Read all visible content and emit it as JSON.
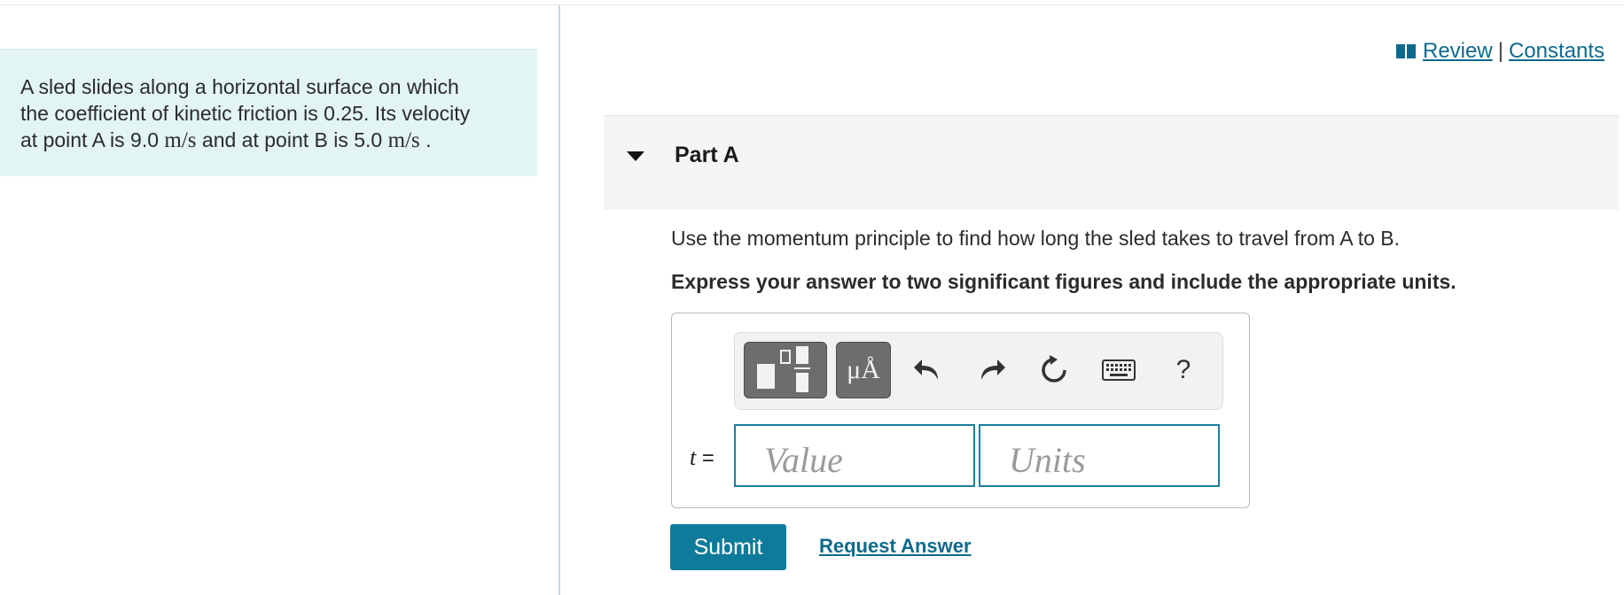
{
  "problem": {
    "line1": "A sled slides along a horizontal surface on which",
    "line2": "the coefficient of kinetic friction is 0.25. Its velocity",
    "line3_start": "at point A is 9.0 ",
    "unit_a": "m/s",
    "line3_mid": " and at point B is 5.0 ",
    "unit_b": "m/s",
    "line3_end": " ."
  },
  "links": {
    "review": " Review",
    "separator": "|",
    "constants": "Constants"
  },
  "part": {
    "title": "Part A"
  },
  "question": "Use the momentum principle to find how long the sled takes to travel from A to B.",
  "instruction": "Express your answer to two significant figures and include the appropriate units.",
  "toolbar": {
    "symbols_label": "μÅ",
    "help_label": "?"
  },
  "answer": {
    "variable": "t",
    "equals": " =",
    "value_placeholder": "Value",
    "units_placeholder": "Units"
  },
  "actions": {
    "submit_label": "Submit",
    "request_label": "Request Answer"
  },
  "colors": {
    "accent": "#0f7b9a",
    "link": "#0d6a8c",
    "problem_bg": "#e3f4f4"
  }
}
